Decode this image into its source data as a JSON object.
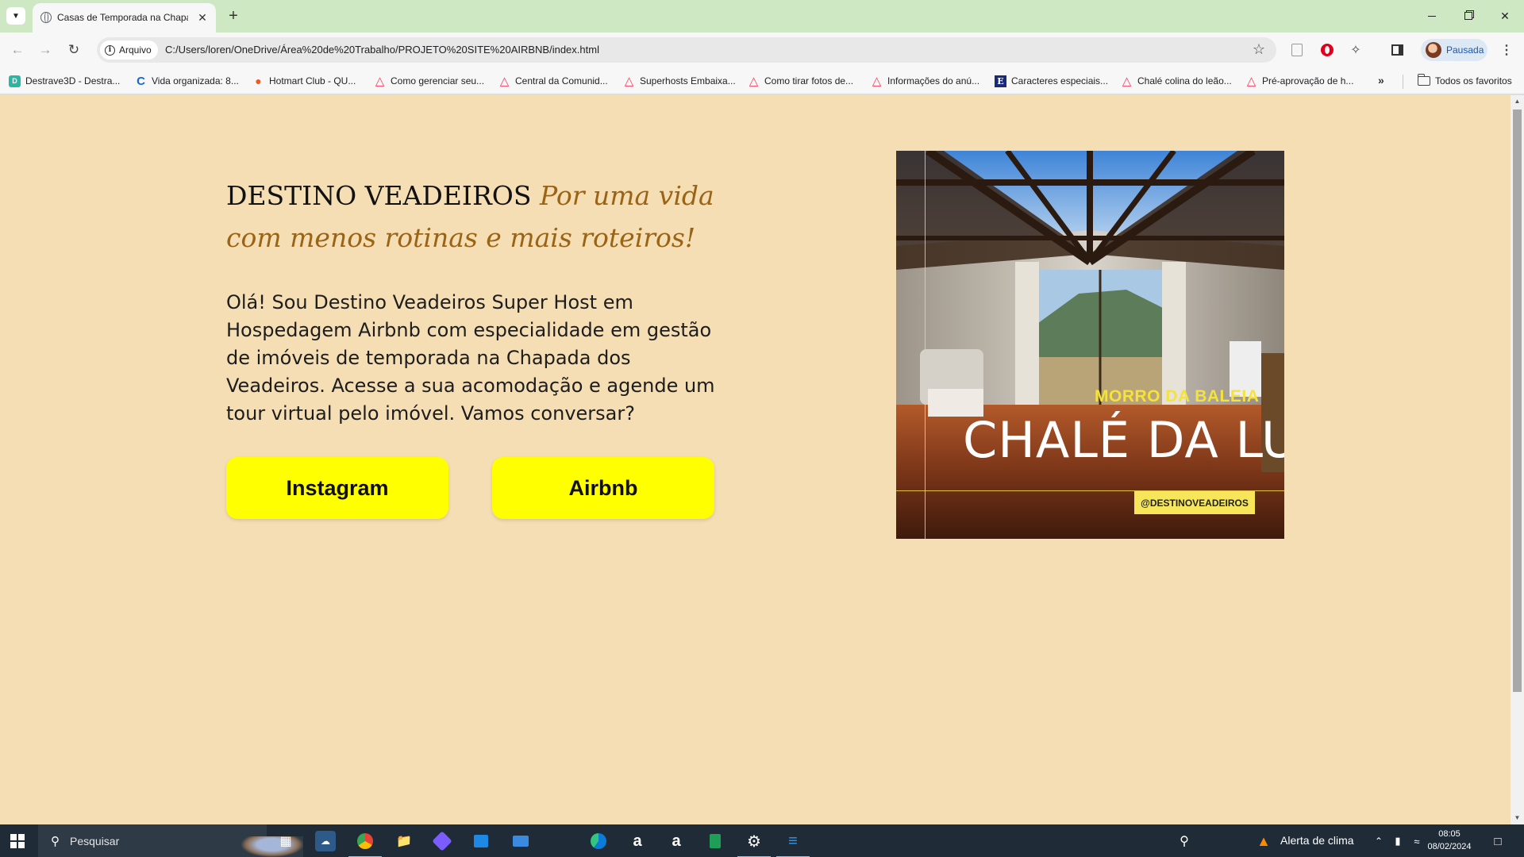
{
  "browser": {
    "tab_title": "Casas de Temporada na Chapada dos Veadeiros",
    "tab_close_glyph": "✕",
    "new_tab_glyph": "+",
    "site_chip_label": "Arquivo",
    "url": "C:/Users/loren/OneDrive/Área%20de%20Trabalho/PROJETO%20SITE%20AIRBNB/index.html",
    "profile_label": "Pausada",
    "bookmarks": [
      {
        "label": "Destrave3D - Destra...",
        "icon": "destrave3d-icon"
      },
      {
        "label": "Vida organizada: 8...",
        "icon": "vida-organizada-icon"
      },
      {
        "label": "Hotmart Club - QU...",
        "icon": "hotmart-icon"
      },
      {
        "label": "Como gerenciar seu...",
        "icon": "airbnb-icon"
      },
      {
        "label": "Central da Comunid...",
        "icon": "airbnb-icon"
      },
      {
        "label": "Superhosts Embaixa...",
        "icon": "airbnb-icon"
      },
      {
        "label": "Como tirar fotos de...",
        "icon": "airbnb-icon"
      },
      {
        "label": "Informações do anú...",
        "icon": "airbnb-icon"
      },
      {
        "label": "Caracteres especiais...",
        "icon": "e-icon"
      },
      {
        "label": "Chalé colina do leão...",
        "icon": "airbnb-icon"
      },
      {
        "label": "Pré-aprovação de h...",
        "icon": "airbnb-icon"
      }
    ],
    "all_bookmarks_label": "Todos os favoritos"
  },
  "page": {
    "brand": "DESTINO VEADEIROS",
    "slogan": "Por uma vida com menos rotinas e mais roteiros!",
    "intro": "Olá! Sou Destino Veadeiros Super Host em Hospedagem Airbnb com especialidade em gestão de imóveis de temporada na Chapada dos Veadeiros. Acesse a sua acomodação e agende um tour virtual pelo imóvel. Vamos conversar?",
    "buttons": {
      "instagram": "Instagram",
      "airbnb": "Airbnb"
    },
    "photo": {
      "subtitle": "MORRO DA BALEIA",
      "title": "CHALÉ DA LUZ",
      "handle": "@DESTINOVEADEIROS"
    }
  },
  "taskbar": {
    "search_placeholder": "Pesquisar",
    "weather_label": "Alerta de clima",
    "time": "08:05",
    "date": "08/02/2024"
  },
  "colors": {
    "page_background": "#f5deb3",
    "slogan": "#9a6315",
    "button": "#ffff00",
    "tabbar": "#cfe8c4",
    "photo_accent": "#f5e23a"
  }
}
